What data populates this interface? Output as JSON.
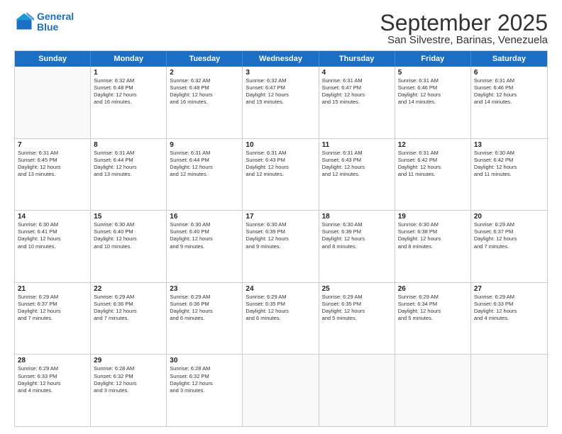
{
  "header": {
    "logo_line1": "General",
    "logo_line2": "Blue",
    "month_title": "September 2025",
    "location": "San Silvestre, Barinas, Venezuela"
  },
  "days": [
    "Sunday",
    "Monday",
    "Tuesday",
    "Wednesday",
    "Thursday",
    "Friday",
    "Saturday"
  ],
  "rows": [
    [
      {
        "day": "",
        "text": ""
      },
      {
        "day": "1",
        "text": "Sunrise: 6:32 AM\nSunset: 6:48 PM\nDaylight: 12 hours\nand 16 minutes."
      },
      {
        "day": "2",
        "text": "Sunrise: 6:32 AM\nSunset: 6:48 PM\nDaylight: 12 hours\nand 16 minutes."
      },
      {
        "day": "3",
        "text": "Sunrise: 6:32 AM\nSunset: 6:47 PM\nDaylight: 12 hours\nand 15 minutes."
      },
      {
        "day": "4",
        "text": "Sunrise: 6:31 AM\nSunset: 6:47 PM\nDaylight: 12 hours\nand 15 minutes."
      },
      {
        "day": "5",
        "text": "Sunrise: 6:31 AM\nSunset: 6:46 PM\nDaylight: 12 hours\nand 14 minutes."
      },
      {
        "day": "6",
        "text": "Sunrise: 6:31 AM\nSunset: 6:46 PM\nDaylight: 12 hours\nand 14 minutes."
      }
    ],
    [
      {
        "day": "7",
        "text": "Sunrise: 6:31 AM\nSunset: 6:45 PM\nDaylight: 12 hours\nand 13 minutes."
      },
      {
        "day": "8",
        "text": "Sunrise: 6:31 AM\nSunset: 6:44 PM\nDaylight: 12 hours\nand 13 minutes."
      },
      {
        "day": "9",
        "text": "Sunrise: 6:31 AM\nSunset: 6:44 PM\nDaylight: 12 hours\nand 12 minutes."
      },
      {
        "day": "10",
        "text": "Sunrise: 6:31 AM\nSunset: 6:43 PM\nDaylight: 12 hours\nand 12 minutes."
      },
      {
        "day": "11",
        "text": "Sunrise: 6:31 AM\nSunset: 6:43 PM\nDaylight: 12 hours\nand 12 minutes."
      },
      {
        "day": "12",
        "text": "Sunrise: 6:31 AM\nSunset: 6:42 PM\nDaylight: 12 hours\nand 11 minutes."
      },
      {
        "day": "13",
        "text": "Sunrise: 6:30 AM\nSunset: 6:42 PM\nDaylight: 12 hours\nand 11 minutes."
      }
    ],
    [
      {
        "day": "14",
        "text": "Sunrise: 6:30 AM\nSunset: 6:41 PM\nDaylight: 12 hours\nand 10 minutes."
      },
      {
        "day": "15",
        "text": "Sunrise: 6:30 AM\nSunset: 6:40 PM\nDaylight: 12 hours\nand 10 minutes."
      },
      {
        "day": "16",
        "text": "Sunrise: 6:30 AM\nSunset: 6:40 PM\nDaylight: 12 hours\nand 9 minutes."
      },
      {
        "day": "17",
        "text": "Sunrise: 6:30 AM\nSunset: 6:39 PM\nDaylight: 12 hours\nand 9 minutes."
      },
      {
        "day": "18",
        "text": "Sunrise: 6:30 AM\nSunset: 6:39 PM\nDaylight: 12 hours\nand 8 minutes."
      },
      {
        "day": "19",
        "text": "Sunrise: 6:30 AM\nSunset: 6:38 PM\nDaylight: 12 hours\nand 8 minutes."
      },
      {
        "day": "20",
        "text": "Sunrise: 6:29 AM\nSunset: 6:37 PM\nDaylight: 12 hours\nand 7 minutes."
      }
    ],
    [
      {
        "day": "21",
        "text": "Sunrise: 6:29 AM\nSunset: 6:37 PM\nDaylight: 12 hours\nand 7 minutes."
      },
      {
        "day": "22",
        "text": "Sunrise: 6:29 AM\nSunset: 6:36 PM\nDaylight: 12 hours\nand 7 minutes."
      },
      {
        "day": "23",
        "text": "Sunrise: 6:29 AM\nSunset: 6:36 PM\nDaylight: 12 hours\nand 6 minutes."
      },
      {
        "day": "24",
        "text": "Sunrise: 6:29 AM\nSunset: 6:35 PM\nDaylight: 12 hours\nand 6 minutes."
      },
      {
        "day": "25",
        "text": "Sunrise: 6:29 AM\nSunset: 6:35 PM\nDaylight: 12 hours\nand 5 minutes."
      },
      {
        "day": "26",
        "text": "Sunrise: 6:29 AM\nSunset: 6:34 PM\nDaylight: 12 hours\nand 5 minutes."
      },
      {
        "day": "27",
        "text": "Sunrise: 6:29 AM\nSunset: 6:33 PM\nDaylight: 12 hours\nand 4 minutes."
      }
    ],
    [
      {
        "day": "28",
        "text": "Sunrise: 6:29 AM\nSunset: 6:33 PM\nDaylight: 12 hours\nand 4 minutes."
      },
      {
        "day": "29",
        "text": "Sunrise: 6:28 AM\nSunset: 6:32 PM\nDaylight: 12 hours\nand 3 minutes."
      },
      {
        "day": "30",
        "text": "Sunrise: 6:28 AM\nSunset: 6:32 PM\nDaylight: 12 hours\nand 3 minutes."
      },
      {
        "day": "",
        "text": ""
      },
      {
        "day": "",
        "text": ""
      },
      {
        "day": "",
        "text": ""
      },
      {
        "day": "",
        "text": ""
      }
    ]
  ]
}
